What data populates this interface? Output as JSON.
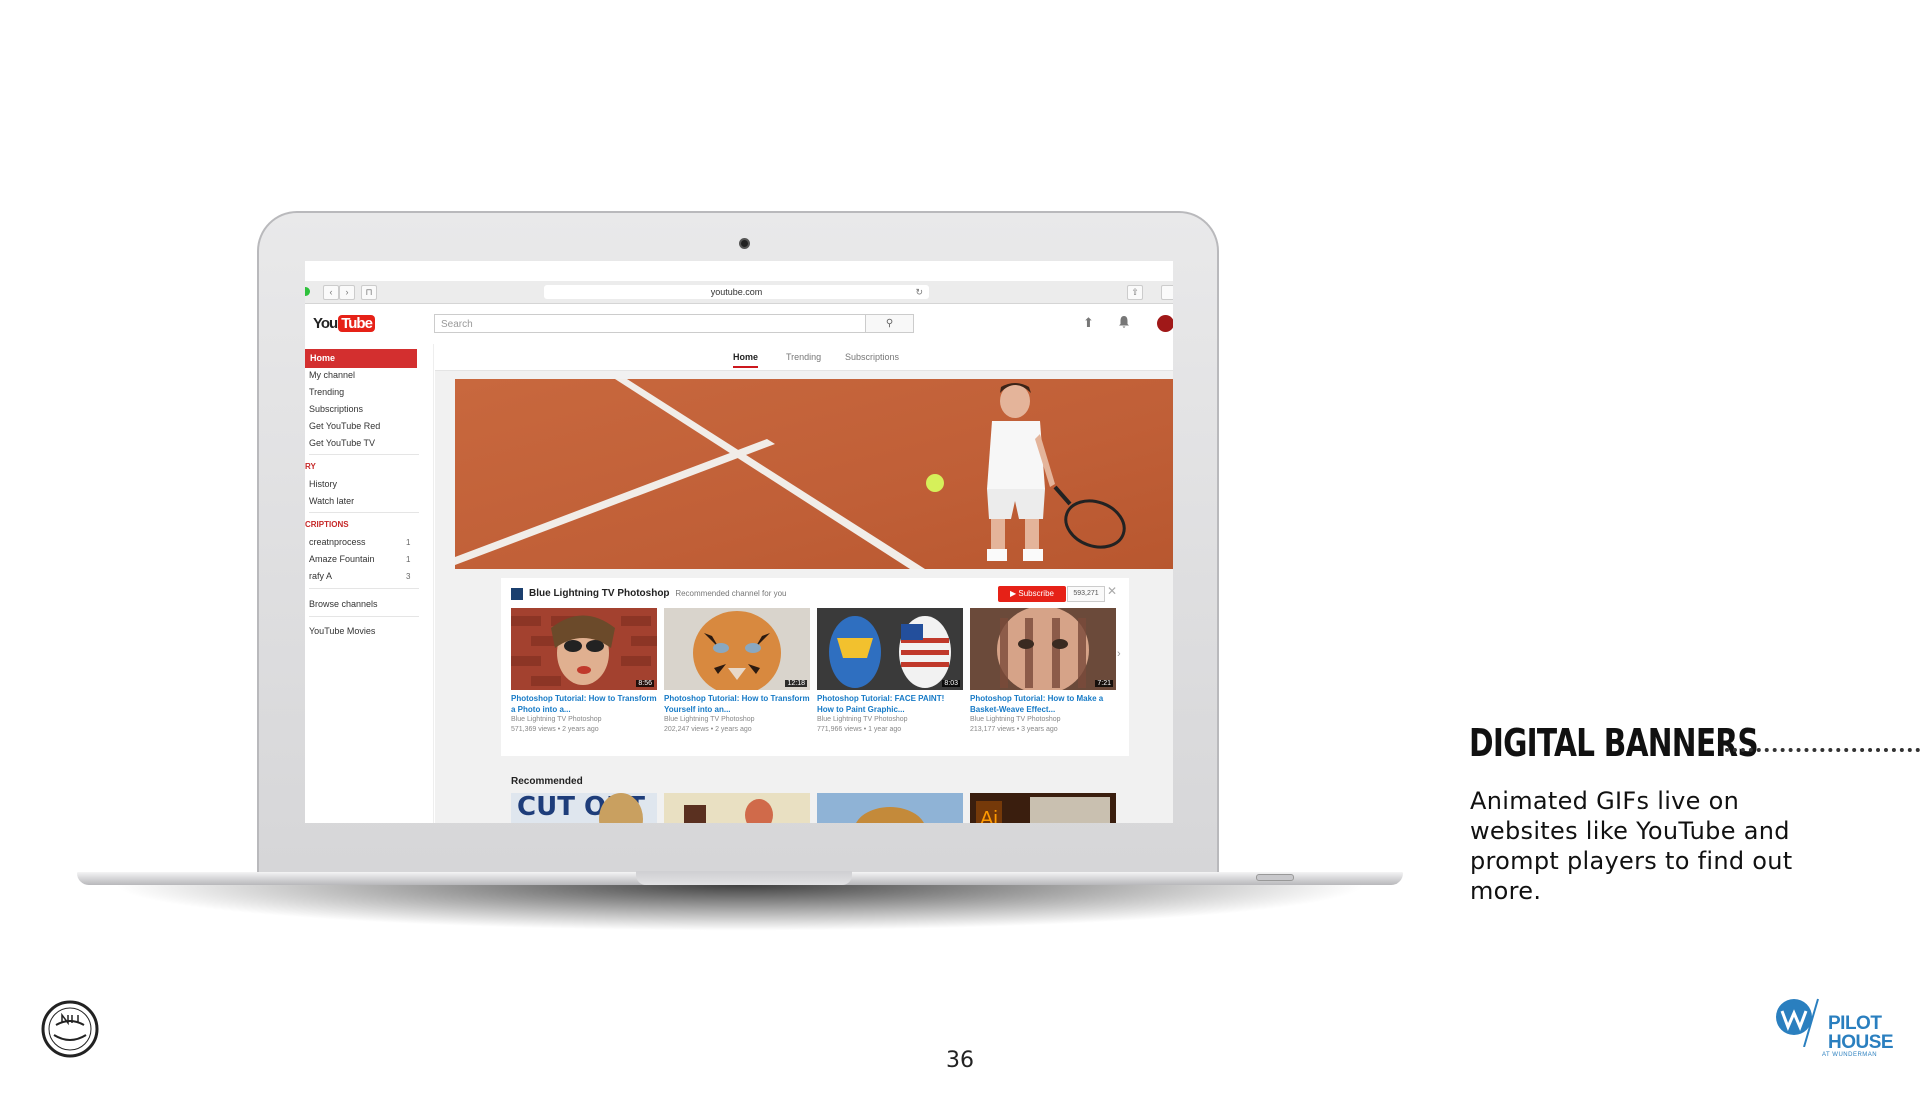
{
  "browser": {
    "url": "youtube.com",
    "tab_btn": "⊓",
    "back": "‹",
    "forward": "›",
    "reload": "↻",
    "share": "⇧"
  },
  "youtube": {
    "logo_you": "You",
    "logo_tube": "Tube",
    "search_placeholder": "Search",
    "search_icon": "⚲",
    "upload_icon": "⬆",
    "bell_icon": "🔔",
    "brand_red": "#e62117",
    "sidebar": {
      "items": [
        "Home",
        "My channel",
        "Trending",
        "Subscriptions",
        "Get YouTube Red",
        "Get YouTube TV"
      ],
      "library_header": "RY",
      "library_items": [
        "History",
        "Watch later"
      ],
      "subs_header": "CRIPTIONS",
      "subscriptions": [
        {
          "name": "creatnprocess",
          "count": "1"
        },
        {
          "name": "Amaze Fountain",
          "count": "1"
        },
        {
          "name": "rafy A",
          "count": "3"
        }
      ],
      "browse": "Browse channels",
      "movies": "YouTube Movies"
    },
    "tabs": [
      "Home",
      "Trending",
      "Subscriptions"
    ],
    "shelf": {
      "channel": "Blue Lightning TV Photoshop",
      "subtitle": "Recommended channel for you",
      "subscribe": "Subscribe",
      "sub_count": "593,271",
      "close": "✕",
      "next": "›",
      "videos": [
        {
          "title": "Photoshop Tutorial: How to Transform a Photo into a...",
          "channel": "Blue Lightning TV Photoshop",
          "meta": "571,369 views • 2 years ago",
          "duration": "8:56"
        },
        {
          "title": "Photoshop Tutorial: How to Transform Yourself into an...",
          "channel": "Blue Lightning TV Photoshop",
          "meta": "202,247 views • 2 years ago",
          "duration": "12:18"
        },
        {
          "title": "Photoshop Tutorial: FACE PAINT! How to Paint Graphic...",
          "channel": "Blue Lightning TV Photoshop",
          "meta": "771,966 views • 1 year ago",
          "duration": "8:03"
        },
        {
          "title": "Photoshop Tutorial: How to Make a Basket-Weave Effect...",
          "channel": "Blue Lightning TV Photoshop",
          "meta": "213,177 views • 3 years ago",
          "duration": "7:21"
        }
      ]
    },
    "recommended": "Recommended",
    "rec_thumb_text": "CUT OUT"
  },
  "slide": {
    "heading": "DIGITAL BANNERS",
    "body": "Animated GIFs live on websites like YouTube and prompt players to find out more.",
    "page_number": "36",
    "pilot_logo": "PILOT HOUSE",
    "pilot_sub": "AT WUNDERMAN",
    "netgen_logo": "NET GENERATION"
  }
}
